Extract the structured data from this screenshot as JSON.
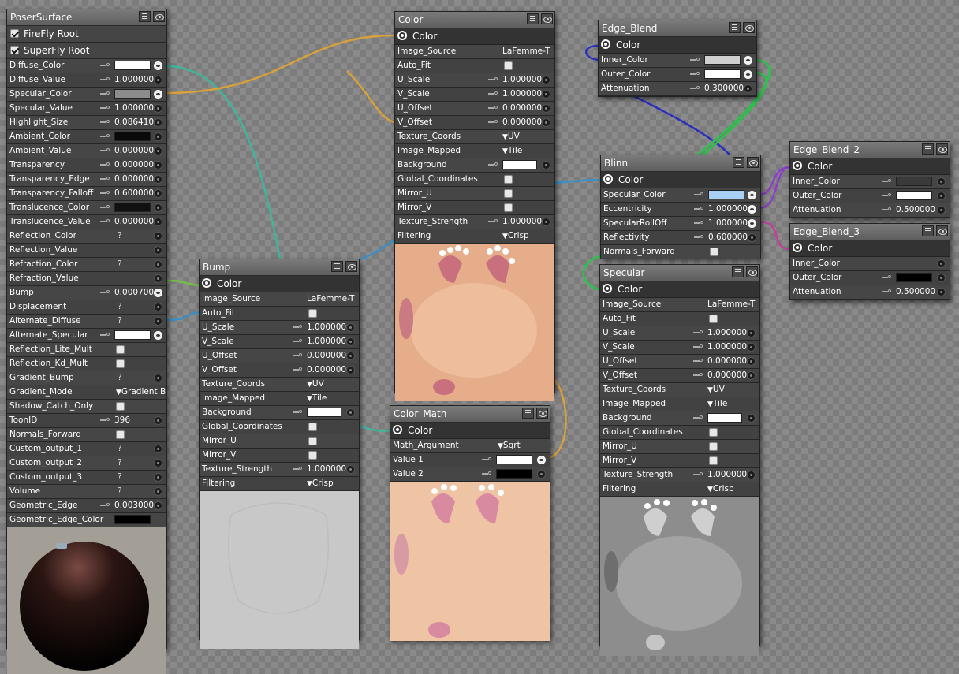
{
  "nodes": {
    "poser_surface": {
      "title": "PoserSurface",
      "roots": [
        "FireFly Root",
        "SuperFly Root"
      ],
      "rows": [
        {
          "label": "Diffuse_Color",
          "swatch": "#ffffff",
          "socket": "on"
        },
        {
          "label": "Diffuse_Value",
          "value": "1.000000",
          "socket": "off"
        },
        {
          "label": "Specular_Color",
          "swatch": "#8c8c8c",
          "socket": "on"
        },
        {
          "label": "Specular_Value",
          "value": "1.000000",
          "socket": "off"
        },
        {
          "label": "Highlight_Size",
          "value": "0.086410",
          "socket": "off"
        },
        {
          "label": "Ambient_Color",
          "swatch": "#0a0a0a",
          "socket": "off"
        },
        {
          "label": "Ambient_Value",
          "value": "0.000000",
          "socket": "off"
        },
        {
          "label": "Transparency",
          "value": "0.000000",
          "socket": "off"
        },
        {
          "label": "Transparency_Edge",
          "value": "0.000000",
          "socket": "off"
        },
        {
          "label": "Transparency_Falloff",
          "value": "0.600000",
          "socket": "off"
        },
        {
          "label": "Translucence_Color",
          "swatch": "#111111",
          "socket": "off"
        },
        {
          "label": "Translucence_Value",
          "value": "0.000000",
          "socket": "off"
        },
        {
          "label": "Reflection_Color",
          "q": "?",
          "socket": "off"
        },
        {
          "label": "Reflection_Value",
          "socket": "off"
        },
        {
          "label": "Refraction_Color",
          "q": "?",
          "socket": "off"
        },
        {
          "label": "Refraction_Value",
          "socket": "off"
        },
        {
          "label": "Bump",
          "value": "0.000700",
          "socket": "on"
        },
        {
          "label": "Displacement",
          "q": "?",
          "socket": "off"
        },
        {
          "label": "Alternate_Diffuse",
          "q": "?",
          "socket": "off"
        },
        {
          "label": "Alternate_Specular",
          "swatch": "#ffffff",
          "socket": "on"
        },
        {
          "label": "Reflection_Lite_Mult",
          "checkbox": true
        },
        {
          "label": "Reflection_Kd_Mult",
          "checkbox": true
        },
        {
          "label": "Gradient_Bump",
          "q": "?",
          "socket": "off"
        },
        {
          "label": "Gradient_Mode",
          "dropdown": "Gradient B"
        },
        {
          "label": "Shadow_Catch_Only",
          "checkbox": true
        },
        {
          "label": "ToonID",
          "value": "396",
          "socket": "off"
        },
        {
          "label": "Normals_Forward",
          "checkbox": true
        },
        {
          "label": "Custom_output_1",
          "q": "?",
          "socket": "off"
        },
        {
          "label": "Custom_output_2",
          "q": "?",
          "socket": "off"
        },
        {
          "label": "Custom_output_3",
          "q": "?",
          "socket": "off"
        },
        {
          "label": "Volume",
          "q": "?",
          "socket": "off"
        },
        {
          "label": "Geometric_Edge",
          "value": "0.003000",
          "socket": "off"
        },
        {
          "label": "Geometric_Edge_Color",
          "swatch": "#000000"
        }
      ]
    },
    "color": {
      "title": "Color",
      "output": "Color",
      "rows": [
        {
          "label": "Image_Source",
          "text": "LaFemme-T"
        },
        {
          "label": "Auto_Fit",
          "checkbox": true
        },
        {
          "label": "U_Scale",
          "value": "1.000000",
          "socket": "off"
        },
        {
          "label": "V_Scale",
          "value": "1.000000",
          "socket": "off"
        },
        {
          "label": "U_Offset",
          "value": "0.000000",
          "socket": "off"
        },
        {
          "label": "V_Offset",
          "value": "0.000000",
          "socket": "off"
        },
        {
          "label": "Texture_Coords",
          "dropdown": "UV"
        },
        {
          "label": "Image_Mapped",
          "dropdown": "Tile"
        },
        {
          "label": "Background",
          "swatch": "#ffffff",
          "socket": "off"
        },
        {
          "label": "Global_Coordinates",
          "checkbox": true
        },
        {
          "label": "Mirror_U",
          "checkbox": true
        },
        {
          "label": "Mirror_V",
          "checkbox": true
        },
        {
          "label": "Texture_Strength",
          "value": "1.000000",
          "socket": "off"
        },
        {
          "label": "Filtering",
          "dropdown": "Crisp"
        }
      ]
    },
    "bump": {
      "title": "Bump",
      "output": "Color",
      "rows": [
        {
          "label": "Image_Source",
          "text": "LaFemme-T"
        },
        {
          "label": "Auto_Fit",
          "checkbox": true
        },
        {
          "label": "U_Scale",
          "value": "1.000000",
          "socket": "off"
        },
        {
          "label": "V_Scale",
          "value": "1.000000",
          "socket": "off"
        },
        {
          "label": "U_Offset",
          "value": "0.000000",
          "socket": "off"
        },
        {
          "label": "V_Offset",
          "value": "0.000000",
          "socket": "off"
        },
        {
          "label": "Texture_Coords",
          "dropdown": "UV"
        },
        {
          "label": "Image_Mapped",
          "dropdown": "Tile"
        },
        {
          "label": "Background",
          "swatch": "#ffffff",
          "socket": "off"
        },
        {
          "label": "Global_Coordinates",
          "checkbox": true
        },
        {
          "label": "Mirror_U",
          "checkbox": true
        },
        {
          "label": "Mirror_V",
          "checkbox": true
        },
        {
          "label": "Texture_Strength",
          "value": "1.000000",
          "socket": "off"
        },
        {
          "label": "Filtering",
          "dropdown": "Crisp"
        }
      ]
    },
    "color_math": {
      "title": "Color_Math",
      "output": "Color",
      "rows": [
        {
          "label": "Math_Argument",
          "dropdown": "Sqrt"
        },
        {
          "label": "Value 1",
          "swatch": "#ffffff",
          "socket": "on"
        },
        {
          "label": "Value 2",
          "swatch": "#000000",
          "socket": "off"
        }
      ]
    },
    "edge_blend": {
      "title": "Edge_Blend",
      "output": "Color",
      "rows": [
        {
          "label": "Inner_Color",
          "swatch": "#d0d0d0",
          "socket": "on"
        },
        {
          "label": "Outer_Color",
          "swatch": "#ffffff",
          "socket": "on"
        },
        {
          "label": "Attenuation",
          "value": "0.300000",
          "socket": "off"
        }
      ]
    },
    "blinn": {
      "title": "Blinn",
      "output": "Color",
      "rows": [
        {
          "label": "Specular_Color",
          "swatch": "#a8d0f5",
          "socket": "on"
        },
        {
          "label": "Eccentricity",
          "value": "1.000000",
          "socket": "on"
        },
        {
          "label": "SpecularRollOff",
          "value": "1.000000",
          "socket": "on"
        },
        {
          "label": "Reflectivity",
          "value": "0.600000",
          "socket": "off"
        },
        {
          "label": "Normals_Forward",
          "checkbox": true
        }
      ]
    },
    "edge_blend_2": {
      "title": "Edge_Blend_2",
      "output": "Color",
      "rows": [
        {
          "label": "Inner_Color",
          "swatch": "#3a3a3a",
          "socket": "off"
        },
        {
          "label": "Outer_Color",
          "swatch": "#ffffff",
          "socket": "off"
        },
        {
          "label": "Attenuation",
          "value": "0.500000",
          "socket": "off"
        }
      ]
    },
    "edge_blend_3": {
      "title": "Edge_Blend_3",
      "output": "Color",
      "rows": [
        {
          "label": "Inner_Color",
          "socket": "off"
        },
        {
          "label": "Outer_Color",
          "swatch": "#000000",
          "socket": "off"
        },
        {
          "label": "Attenuation",
          "value": "0.500000",
          "socket": "off"
        }
      ]
    },
    "specular": {
      "title": "Specular",
      "output": "Color",
      "rows": [
        {
          "label": "Image_Source",
          "text": "LaFemme-T"
        },
        {
          "label": "Auto_Fit",
          "checkbox": true
        },
        {
          "label": "U_Scale",
          "value": "1.000000",
          "socket": "off"
        },
        {
          "label": "V_Scale",
          "value": "1.000000",
          "socket": "off"
        },
        {
          "label": "U_Offset",
          "value": "0.000000",
          "socket": "off"
        },
        {
          "label": "V_Offset",
          "value": "0.000000",
          "socket": "off"
        },
        {
          "label": "Texture_Coords",
          "dropdown": "UV"
        },
        {
          "label": "Image_Mapped",
          "dropdown": "Tile"
        },
        {
          "label": "Background",
          "swatch": "#ffffff",
          "socket": "off"
        },
        {
          "label": "Global_Coordinates",
          "checkbox": true
        },
        {
          "label": "Mirror_U",
          "checkbox": true
        },
        {
          "label": "Mirror_V",
          "checkbox": true
        },
        {
          "label": "Texture_Strength",
          "value": "1.000000",
          "socket": "off"
        },
        {
          "label": "Filtering",
          "dropdown": "Crisp"
        }
      ]
    }
  },
  "colors": {
    "wire_teal": "#3fb59a",
    "wire_orange": "#d9a13a",
    "wire_blue": "#3b8fc8",
    "wire_green": "#74c043",
    "wire_navy": "#2b2fc0",
    "wire_bright_green": "#29c44a",
    "wire_purple": "#8b3ec8",
    "wire_magenta": "#c43c9e",
    "texture_skin": "#e9b291",
    "texture_gray": "#8f8f8f",
    "bump_gray": "#c9c9c9"
  }
}
